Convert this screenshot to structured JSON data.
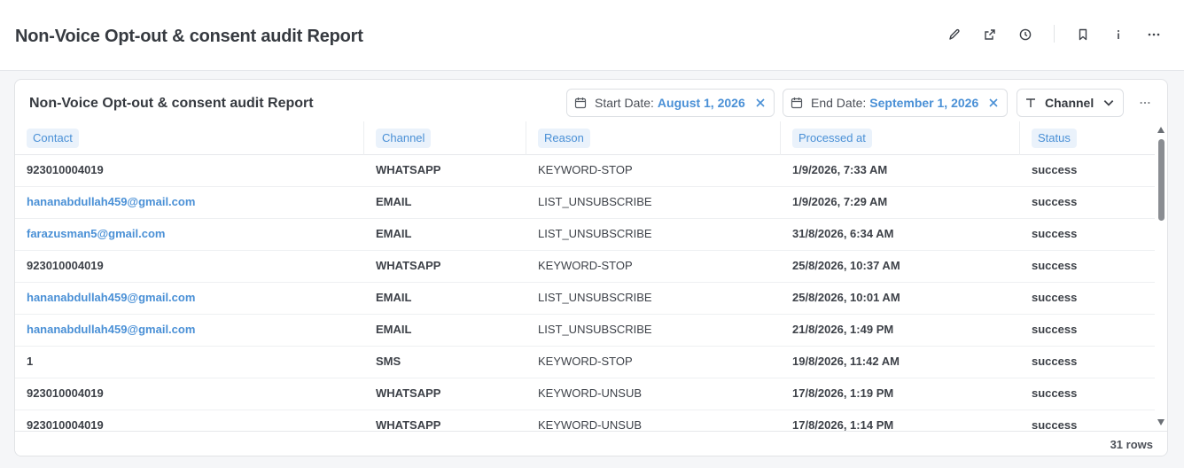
{
  "header": {
    "title": "Non-Voice Opt-out & consent audit Report",
    "icons": [
      "pencil-icon",
      "external-link-icon",
      "clock-icon",
      "bookmark-icon",
      "info-icon",
      "more-icon"
    ]
  },
  "card": {
    "title": "Non-Voice Opt-out & consent audit Report",
    "filters": {
      "start_label": "Start Date:",
      "start_value": "August 1, 2026",
      "end_label": "End Date:",
      "end_value": "September 1, 2026",
      "channel_label": "Channel"
    }
  },
  "table": {
    "columns": [
      "Contact",
      "Channel",
      "Reason",
      "Processed at",
      "Status"
    ],
    "rows": [
      [
        "923010004019",
        "WHATSAPP",
        "KEYWORD-STOP",
        "1/9/2026, 7:33 AM",
        "success"
      ],
      [
        "hananabdullah459@gmail.com",
        "EMAIL",
        "LIST_UNSUBSCRIBE",
        "1/9/2026, 7:29 AM",
        "success"
      ],
      [
        "farazusman5@gmail.com",
        "EMAIL",
        "LIST_UNSUBSCRIBE",
        "31/8/2026, 6:34 AM",
        "success"
      ],
      [
        "923010004019",
        "WHATSAPP",
        "KEYWORD-STOP",
        "25/8/2026, 10:37 AM",
        "success"
      ],
      [
        "hananabdullah459@gmail.com",
        "EMAIL",
        "LIST_UNSUBSCRIBE",
        "25/8/2026, 10:01 AM",
        "success"
      ],
      [
        "hananabdullah459@gmail.com",
        "EMAIL",
        "LIST_UNSUBSCRIBE",
        "21/8/2026, 1:49 PM",
        "success"
      ],
      [
        "1",
        "SMS",
        "KEYWORD-STOP",
        "19/8/2026, 11:42 AM",
        "success"
      ],
      [
        "923010004019",
        "WHATSAPP",
        "KEYWORD-UNSUB",
        "17/8/2026, 1:19 PM",
        "success"
      ],
      [
        "923010004019",
        "WHATSAPP",
        "KEYWORD-UNSUB",
        "17/8/2026, 1:14 PM",
        "success"
      ]
    ],
    "row_count": "31 rows"
  },
  "colors": {
    "accent": "#4a90d6",
    "pill_bg": "#eaf2fb",
    "text": "#363a40"
  }
}
